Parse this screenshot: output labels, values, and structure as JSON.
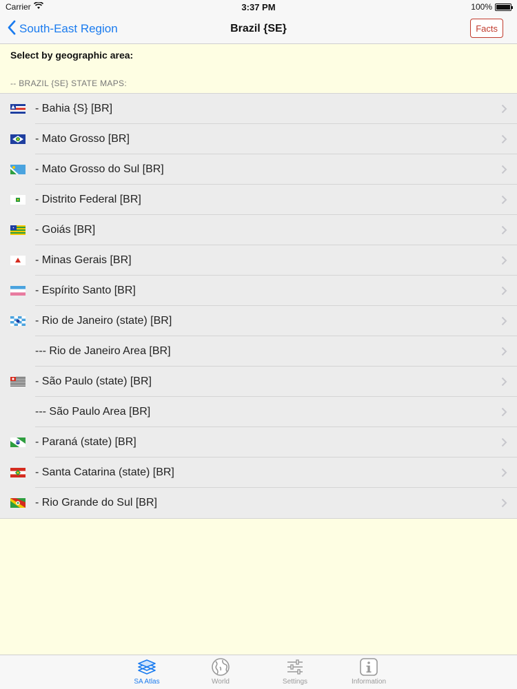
{
  "status": {
    "carrier": "Carrier",
    "time": "3:37 PM",
    "battery": "100%"
  },
  "nav": {
    "back_label": "South-East Region",
    "title": "Brazil {SE}",
    "facts_label": "Facts"
  },
  "prompt": "Select by geographic area:",
  "section_header": "-- BRAZIL {SE} STATE MAPS:",
  "rows": [
    {
      "label": "- Bahia {S} [BR]",
      "flag": "bahia-flag"
    },
    {
      "label": "- Mato Grosso [BR]",
      "flag": "mato-grosso-flag"
    },
    {
      "label": "- Mato Grosso do Sul [BR]",
      "flag": "mato-grosso-do-sul-flag"
    },
    {
      "label": "- Distrito Federal [BR]",
      "flag": "distrito-federal-flag"
    },
    {
      "label": "- Goiás [BR]",
      "flag": "goias-flag"
    },
    {
      "label": "- Minas Gerais [BR]",
      "flag": "minas-gerais-flag"
    },
    {
      "label": "- Espírito Santo [BR]",
      "flag": "espirito-santo-flag"
    },
    {
      "label": "- Rio de Janeiro (state) [BR]",
      "flag": "rio-de-janeiro-flag"
    },
    {
      "label": "--- Rio de Janeiro Area [BR]",
      "flag": ""
    },
    {
      "label": "- São Paulo (state) [BR]",
      "flag": "sao-paulo-flag"
    },
    {
      "label": "--- São Paulo Area [BR]",
      "flag": ""
    },
    {
      "label": "- Paraná (state) [BR]",
      "flag": "parana-flag"
    },
    {
      "label": "- Santa Catarina (state) [BR]",
      "flag": "santa-catarina-flag"
    },
    {
      "label": "- Rio Grande do Sul [BR]",
      "flag": "rio-grande-do-sul-flag"
    }
  ],
  "tabs": [
    {
      "label": "SA Atlas",
      "icon": "atlas-icon",
      "active": true
    },
    {
      "label": "World",
      "icon": "globe-icon",
      "active": false
    },
    {
      "label": "Settings",
      "icon": "sliders-icon",
      "active": false
    },
    {
      "label": "Information",
      "icon": "info-icon",
      "active": false
    }
  ],
  "colors": {
    "accent": "#1a7bef",
    "facts": "#c0392b",
    "background": "#fefee3",
    "list_background": "#ececec"
  }
}
